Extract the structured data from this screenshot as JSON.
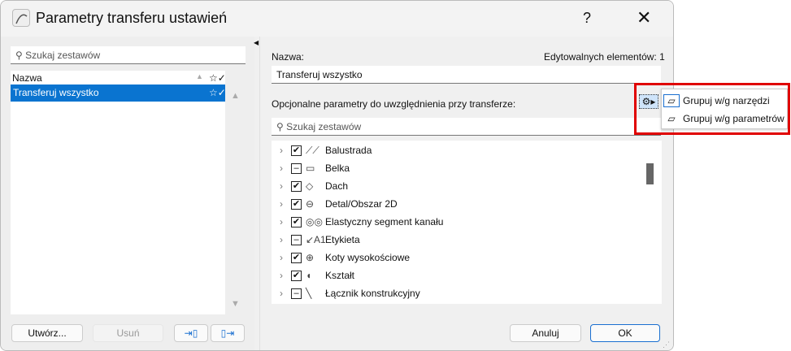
{
  "window": {
    "title": "Parametry transferu ustawień",
    "help": "?",
    "close": "✕"
  },
  "left": {
    "search_placeholder": "Szukaj zestawów",
    "column_name": "Nazwa",
    "items": [
      {
        "label": "Transferuj wszystko"
      }
    ],
    "buttons": {
      "create": "Utwórz...",
      "delete": "Usuń"
    }
  },
  "right": {
    "name_label": "Nazwa:",
    "editable_label": "Edytowalnych elementów: 1",
    "name_value": "Transferuj wszystko",
    "optional_label": "Opcjonalne parametry do uwzględnienia przy transferze:",
    "search_placeholder": "Szukaj zestawów",
    "items": [
      {
        "label": "Balustrada",
        "state": "checked",
        "icon": "railing-icon"
      },
      {
        "label": "Belka",
        "state": "partial",
        "icon": "beam-icon"
      },
      {
        "label": "Dach",
        "state": "checked",
        "icon": "roof-icon"
      },
      {
        "label": "Detal/Obszar 2D",
        "state": "checked",
        "icon": "detail-icon"
      },
      {
        "label": "Elastyczny segment kanału",
        "state": "checked",
        "icon": "flex-duct-icon"
      },
      {
        "label": "Etykieta",
        "state": "partial",
        "icon": "label-icon"
      },
      {
        "label": "Koty wysokościowe",
        "state": "checked",
        "icon": "elevation-icon"
      },
      {
        "label": "Kształt",
        "state": "checked",
        "icon": "shape-icon"
      },
      {
        "label": "Łącznik konstrukcyjny",
        "state": "partial",
        "icon": "connector-icon"
      }
    ],
    "buttons": {
      "cancel": "Anuluj",
      "ok": "OK"
    }
  },
  "menu": {
    "items": [
      {
        "label": "Grupuj w/g narzędzi"
      },
      {
        "label": "Grupuj w/g parametrów"
      }
    ]
  }
}
